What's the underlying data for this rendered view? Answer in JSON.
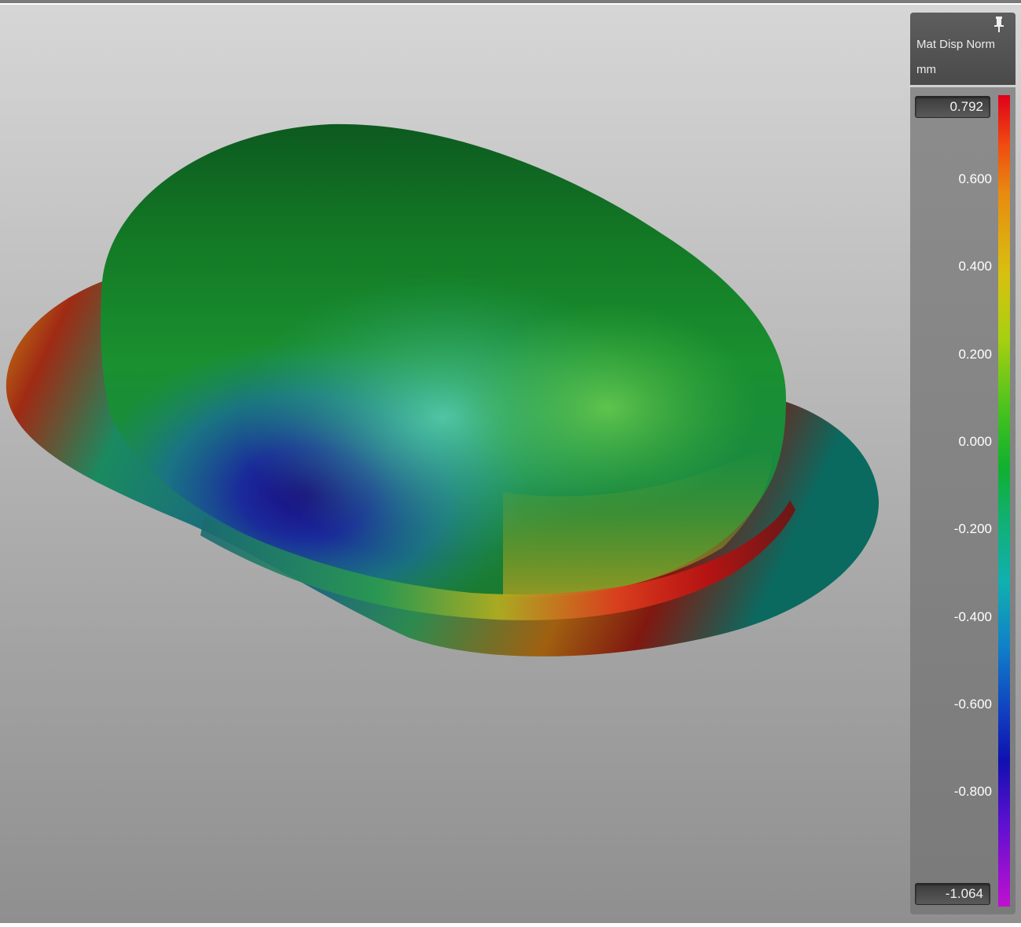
{
  "legend": {
    "title": "Mat Disp Norm",
    "unit": "mm",
    "max_value": "0.792",
    "min_value": "-1.064",
    "ticks": [
      "0.600",
      "0.400",
      "0.200",
      "0.000",
      "-0.200",
      "-0.400",
      "-0.600",
      "-0.800"
    ],
    "colors": {
      "max": "#e0001a",
      "mid": "#10b030",
      "min": "#c010d0"
    }
  },
  "icons": {
    "pin": "pin-icon"
  }
}
